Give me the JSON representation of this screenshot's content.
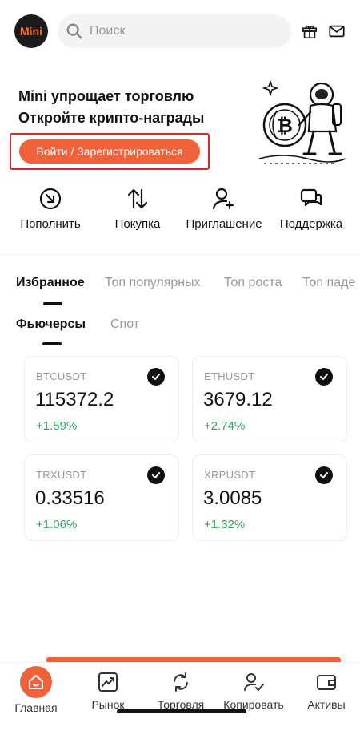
{
  "header": {
    "logo_text": "Mini",
    "search_placeholder": "Поиск",
    "icons": [
      "gift-icon",
      "mail-icon"
    ]
  },
  "promo": {
    "line1": "Mini упрощает торговлю",
    "line2": "Откройте крипто-награды",
    "cta_label": "Войти / Зарегистрироваться"
  },
  "actions": [
    {
      "label": "Пополнить",
      "icon": "deposit-icon"
    },
    {
      "label": "Покупка",
      "icon": "buy-arrows-icon"
    },
    {
      "label": "Приглашение",
      "icon": "invite-user-icon"
    },
    {
      "label": "Поддержка",
      "icon": "support-chat-icon"
    }
  ],
  "market_tabs": [
    "Избранное",
    "Топ популярных",
    "Топ роста",
    "Топ паде"
  ],
  "sub_tabs": [
    "Фьючерсы",
    "Спот"
  ],
  "tickers": [
    {
      "symbol": "BTCUSDT",
      "price": "115372.2",
      "change": "+1.59%"
    },
    {
      "symbol": "ETHUSDT",
      "price": "3679.12",
      "change": "+2.74%"
    },
    {
      "symbol": "TRXUSDT",
      "price": "0.33516",
      "change": "+1.06%"
    },
    {
      "symbol": "XRPUSDT",
      "price": "3.0085",
      "change": "+1.32%"
    }
  ],
  "bottom_nav": [
    {
      "label": "Главная",
      "icon": "home-icon"
    },
    {
      "label": "Рынок",
      "icon": "market-chart-icon"
    },
    {
      "label": "Торговля",
      "icon": "trade-refresh-icon"
    },
    {
      "label": "Копировать",
      "icon": "copy-trade-icon"
    },
    {
      "label": "Активы",
      "icon": "wallet-icon"
    }
  ],
  "colors": {
    "accent": "#f0623a",
    "positive": "#2fa55b",
    "highlight_frame": "#e0262d"
  }
}
